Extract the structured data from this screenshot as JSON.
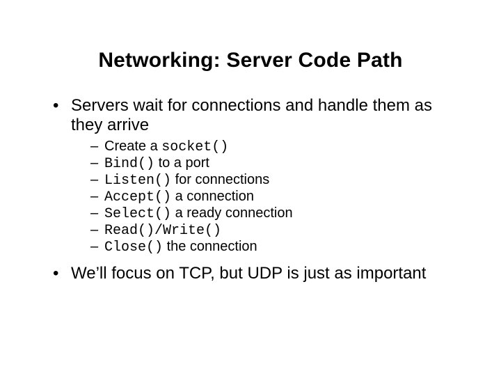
{
  "title": "Networking: Server Code Path",
  "points": {
    "p1": "Servers wait for connections and handle them as they arrive",
    "p2": "We’ll focus on TCP, but UDP is just as important"
  },
  "sub": {
    "s1_pre": "Create a ",
    "s1_code": "socket()",
    "s2_code": "Bind()",
    "s2_post": " to a port",
    "s3_code": "Listen()",
    "s3_post": " for connections",
    "s4_code": "Accept()",
    "s4_post": " a connection",
    "s5_code": "Select()",
    "s5_post": " a ready connection",
    "s6_code": "Read()/Write()",
    "s7_code": "Close()",
    "s7_post": " the connection"
  }
}
